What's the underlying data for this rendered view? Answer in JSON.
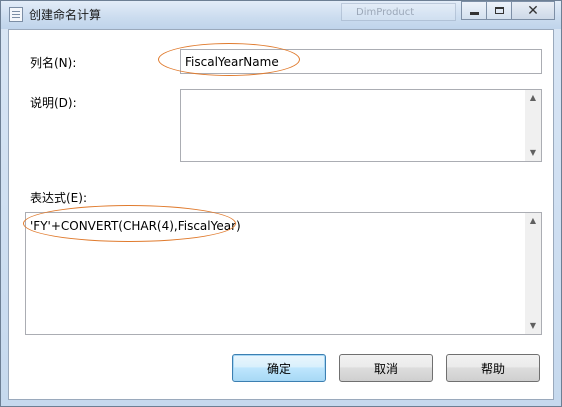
{
  "window": {
    "title": "创建命名计算",
    "background_window_title": "DimProduct"
  },
  "form": {
    "column_name_label": "列名(N):",
    "column_name_value": "FiscalYearName",
    "description_label": "说明(D):",
    "description_value": "",
    "expression_label": "表达式(E):",
    "expression_value": "'FY'+CONVERT(CHAR(4),FiscalYear)"
  },
  "buttons": {
    "ok": "确定",
    "cancel": "取消",
    "help": "帮助"
  },
  "colors": {
    "annotation": "#e07b2e",
    "default_button_border": "#3c7fb1"
  }
}
